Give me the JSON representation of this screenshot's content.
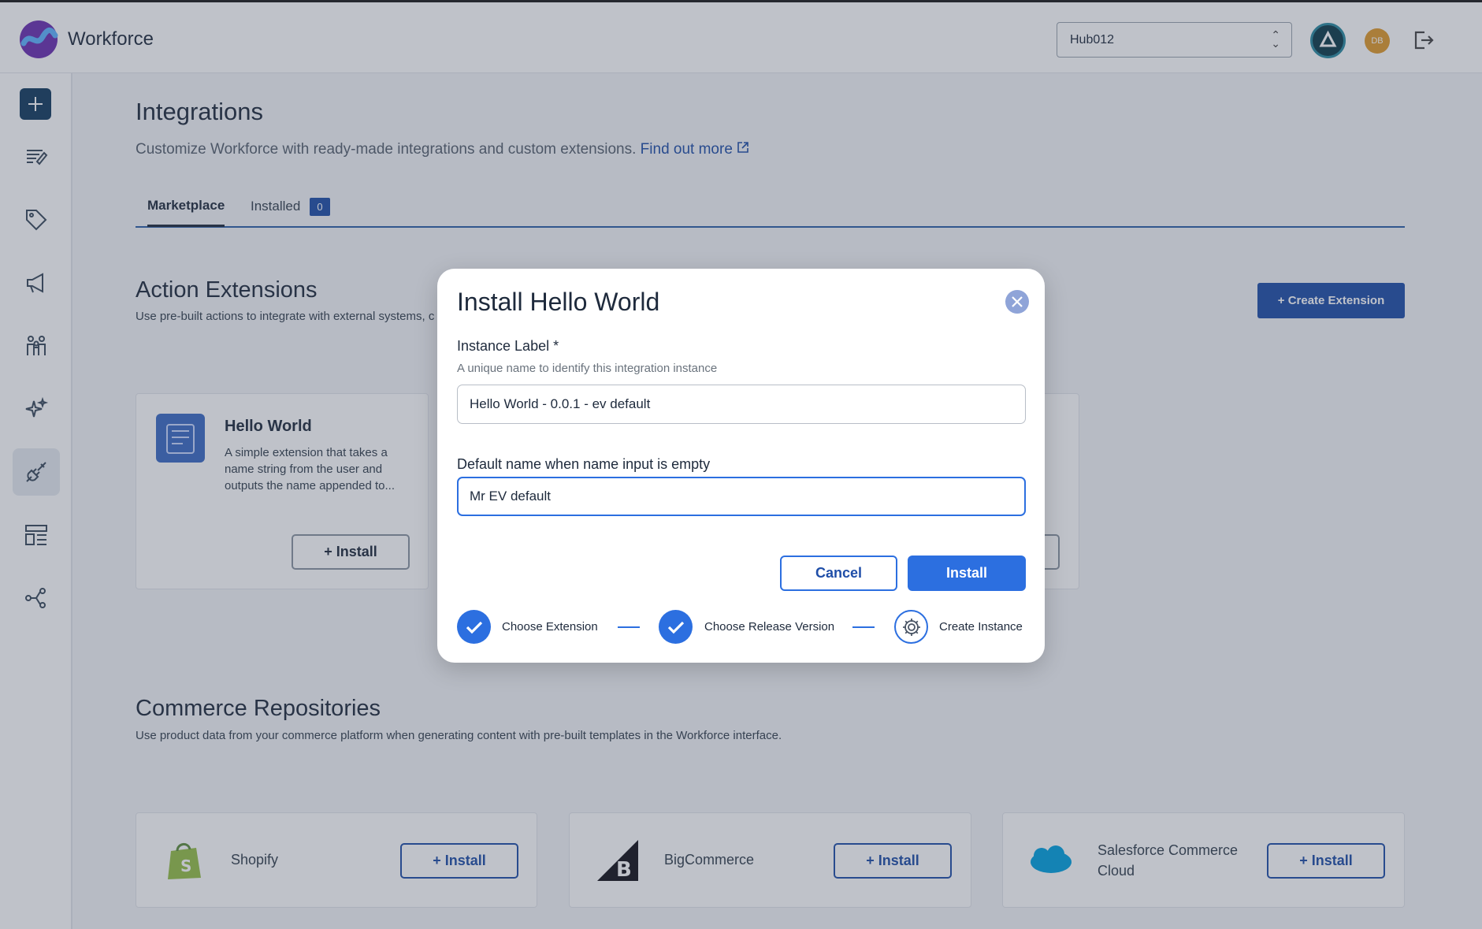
{
  "app": {
    "name": "Workforce"
  },
  "header": {
    "hub_value": "Hub012",
    "avatar_initials": "DB"
  },
  "page": {
    "title": "Integrations",
    "subtitle": "Customize Workforce with ready-made integrations and custom extensions.",
    "find_out_more": "Find out more"
  },
  "tabs": [
    {
      "label": "Marketplace"
    },
    {
      "label": "Installed",
      "badge": "0"
    }
  ],
  "action_extensions": {
    "title": "Action Extensions",
    "subtitle": "Use pre-built actions to integrate with external systems, c",
    "create_button": "+ Create Extension",
    "cards": [
      {
        "title": "Hello World",
        "description": "A simple extension that takes a name string from the user and outputs the name appended to...",
        "install_label": "Install"
      }
    ]
  },
  "commerce": {
    "title": "Commerce Repositories",
    "subtitle": "Use product data from your commerce platform when generating content with pre-built templates in the Workforce interface.",
    "repos": [
      {
        "name": "Shopify",
        "install_label": "Install"
      },
      {
        "name": "BigCommerce",
        "install_label": "Install"
      },
      {
        "name": "Salesforce Commerce Cloud",
        "install_label": "Install"
      }
    ]
  },
  "modal": {
    "title": "Install Hello World",
    "instance_label": {
      "label": "Instance Label *",
      "help": "A unique name to identify this integration instance",
      "value": "Hello World - 0.0.1 - ev default"
    },
    "default_name": {
      "label": "Default name when name input is empty",
      "value": "Mr EV default"
    },
    "cancel_label": "Cancel",
    "install_label": "Install",
    "steps": [
      {
        "label": "Choose Extension",
        "state": "done"
      },
      {
        "label": "Choose Release Version",
        "state": "done"
      },
      {
        "label": "Create Instance",
        "state": "current"
      }
    ]
  },
  "colors": {
    "primary": "#2c6fe0",
    "brand_dark": "#1f4ea8",
    "sidebar_active": "#e6ebf1"
  }
}
